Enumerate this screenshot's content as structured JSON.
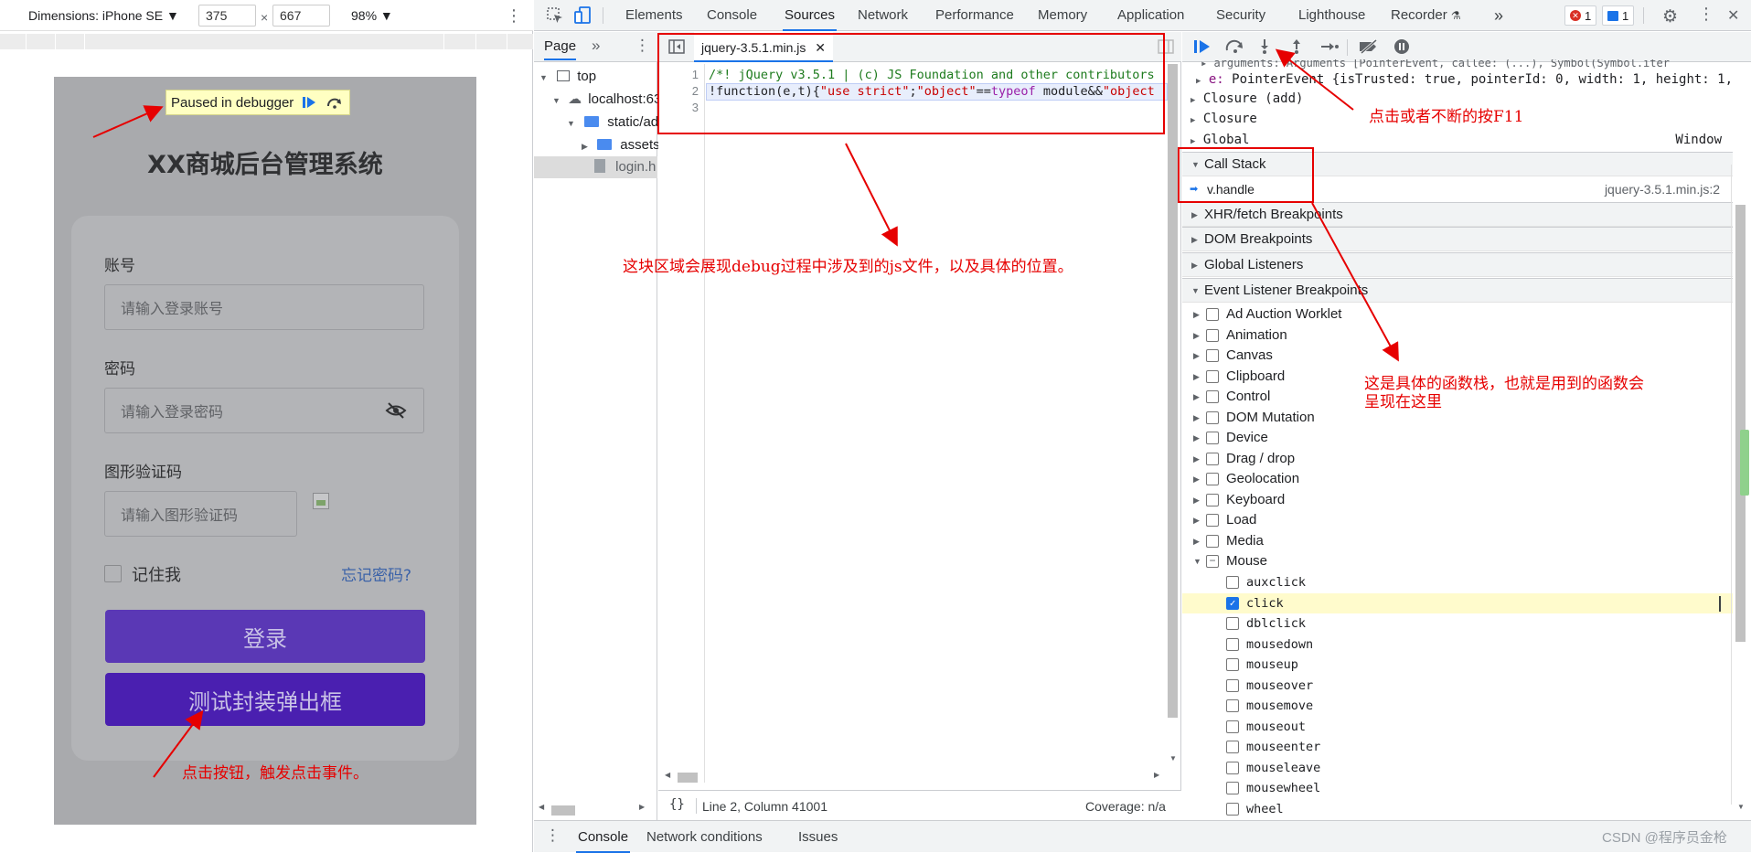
{
  "device_toolbar": {
    "dimensions_label": "Dimensions: iPhone SE",
    "width": "375",
    "times": "×",
    "height": "667",
    "zoom": "98%"
  },
  "phone": {
    "paused_text": "Paused in debugger",
    "title": "XX商城后台管理系统",
    "account_label": "账号",
    "account_placeholder": "请输入登录账号",
    "password_label": "密码",
    "password_placeholder": "请输入登录密码",
    "captcha_label": "图形验证码",
    "captcha_placeholder": "请输入图形验证码",
    "remember_label": "记住我",
    "forgot_link": "忘记密码?",
    "login_button": "登录",
    "test_button": "测试封装弹出框"
  },
  "devtools_tabs": {
    "items": [
      "Elements",
      "Console",
      "Sources",
      "Network",
      "Performance",
      "Memory",
      "Application",
      "Security",
      "Lighthouse",
      "Recorder"
    ],
    "active": "Sources",
    "more": "»",
    "errors": "1",
    "messages": "1"
  },
  "navigator": {
    "tab_label": "Page",
    "more": "»",
    "tree": [
      "top",
      "localhost:63",
      "static/ad",
      "assets",
      "login.h"
    ]
  },
  "editor": {
    "file_tab": "jquery-3.5.1.min.js",
    "lines": [
      {
        "num": "1",
        "text": "/*! jQuery v3.5.1 | (c) JS Foundation and other contributors"
      },
      {
        "num": "2",
        "text_parts": [
          "!function(e,t){",
          "\"use strict\"",
          ";",
          "\"object\"",
          "==",
          "typeof",
          " module&&",
          "\"object"
        ]
      },
      {
        "num": "3",
        "text": ""
      }
    ],
    "status_braces": "{}",
    "status_position": "Line 2, Column 41001",
    "status_coverage": "Coverage: n/a"
  },
  "scope": {
    "line0": "▸ arguments: Arguments [PointerEvent, callee: (...), Symbol(Symbol.iter",
    "line1_key": "e:",
    "line1_val": " PointerEvent {isTrusted: true, pointerId: 0, width: 1, height: 1, p",
    "closure_add": "Closure (add)",
    "closure": "Closure",
    "global": "Global",
    "global_val": "Window"
  },
  "call_stack": {
    "header": "Call Stack",
    "frame_name": "v.handle",
    "frame_loc": "jquery-3.5.1.min.js:2"
  },
  "sections": {
    "xhr": "XHR/fetch Breakpoints",
    "dom": "DOM Breakpoints",
    "global_listeners": "Global Listeners",
    "event_listener": "Event Listener Breakpoints"
  },
  "event_categories": [
    "Ad Auction Worklet",
    "Animation",
    "Canvas",
    "Clipboard",
    "Control",
    "DOM Mutation",
    "Device",
    "Drag / drop",
    "Geolocation",
    "Keyboard",
    "Load",
    "Media",
    "Mouse"
  ],
  "mouse_events": [
    {
      "name": "auxclick",
      "checked": false
    },
    {
      "name": "click",
      "checked": true
    },
    {
      "name": "dblclick",
      "checked": false
    },
    {
      "name": "mousedown",
      "checked": false
    },
    {
      "name": "mouseup",
      "checked": false
    },
    {
      "name": "mouseover",
      "checked": false
    },
    {
      "name": "mousemove",
      "checked": false
    },
    {
      "name": "mouseout",
      "checked": false
    },
    {
      "name": "mouseenter",
      "checked": false
    },
    {
      "name": "mouseleave",
      "checked": false
    },
    {
      "name": "mousewheel",
      "checked": false
    },
    {
      "name": "wheel",
      "checked": false
    }
  ],
  "drawer": {
    "tabs": [
      "Console",
      "Network conditions",
      "Issues"
    ],
    "active": "Console"
  },
  "annotations": {
    "click_f11": "点击或者不断的按F11",
    "js_area": "这块区域会展现debug过程中涉及到的js文件，以及具体的位置。",
    "call_stack_note_1": "这是具体的函数栈，也就是用到的函数会",
    "call_stack_note_2": "呈现在这里",
    "click_button": "点击按钮，触发点击事件。"
  },
  "watermark": "CSDN @程序员金枪",
  "colors": {
    "accent": "#1a73e8",
    "annotation_red": "#e60000",
    "login_button": "#5a38b5",
    "test_button": "#4a1fb0"
  }
}
